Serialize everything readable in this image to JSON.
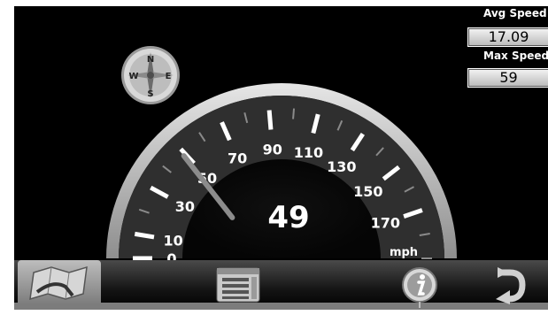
{
  "gauge": {
    "ticks": [
      "0",
      "10",
      "30",
      "50",
      "70",
      "90",
      "110",
      "130",
      "150",
      "170"
    ],
    "unit": "mph",
    "needle_value": 49
  },
  "speed": {
    "current": "49"
  },
  "stats": {
    "avg_label": "Avg Speed",
    "avg_value": "17.09",
    "max_label": "Max Speed",
    "max_value": "59"
  },
  "compass": {
    "n": "N",
    "e": "E",
    "s": "S",
    "w": "W"
  },
  "toolbar": {
    "buttons": [
      {
        "name": "map-button",
        "icon": "map-icon"
      },
      {
        "name": "menu-button",
        "icon": "list-menu-icon"
      },
      {
        "name": "info-button",
        "icon": "info-icon"
      },
      {
        "name": "back-button",
        "icon": "return-arrow-icon"
      }
    ]
  },
  "colors": {
    "background": "#000000",
    "text": "#ffffff",
    "bezel": "#c8c8c8",
    "needle": "#8c8c8c"
  }
}
